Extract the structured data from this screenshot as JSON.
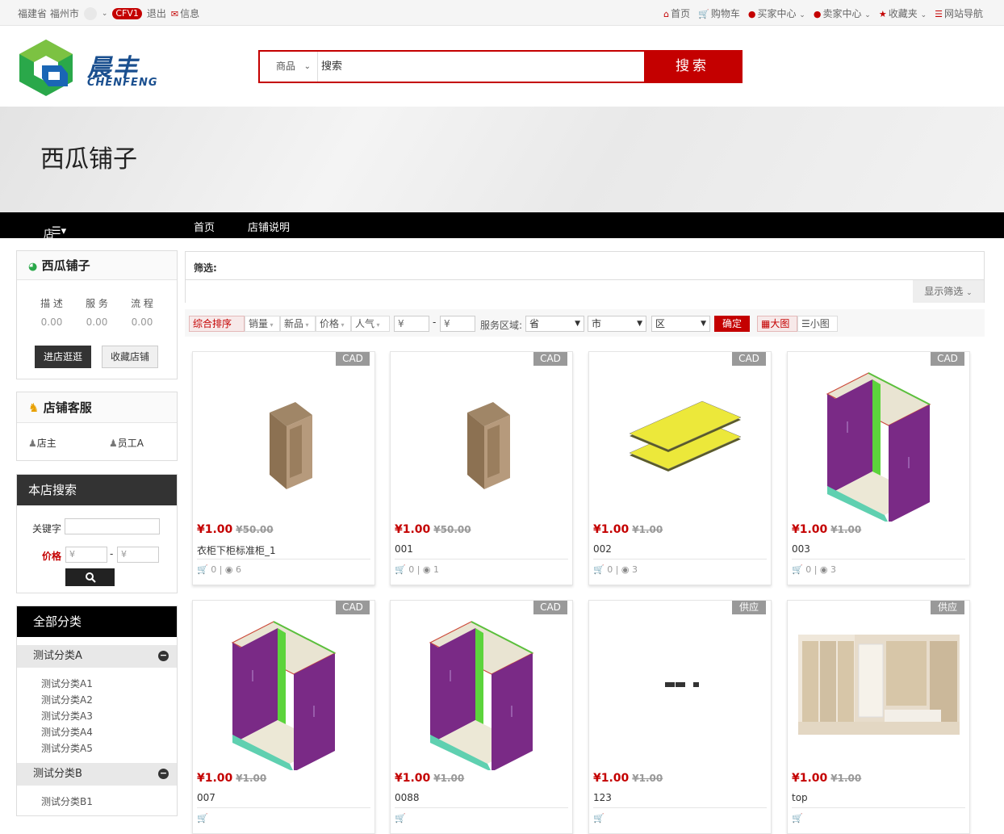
{
  "topbar": {
    "location": "福建省 福州市",
    "version_badge": "CFV1",
    "logout": "退出",
    "messages": "信息",
    "links": [
      "首页",
      "购物车",
      "买家中心",
      "卖家中心",
      "收藏夹",
      "网站导航"
    ]
  },
  "header": {
    "logo_cn": "晨丰",
    "logo_en": "CHENFENG",
    "search_category": "商品",
    "search_value": "搜索",
    "search_button": "搜索"
  },
  "banner": {
    "shop_title": "西瓜铺子"
  },
  "nav": {
    "all_categories": "店铺全部分类",
    "home": "首页",
    "shop_info": "店铺说明"
  },
  "shop_card": {
    "name": "西瓜铺子",
    "stats": [
      {
        "label": "描 述",
        "value": "0.00"
      },
      {
        "label": "服 务",
        "value": "0.00"
      },
      {
        "label": "流 程",
        "value": "0.00"
      }
    ],
    "enter_button": "进店逛逛",
    "favorite_button": "收藏店铺"
  },
  "service": {
    "title": "店铺客服",
    "staff": [
      "店主",
      "员工A"
    ]
  },
  "store_search": {
    "title": "本店搜索",
    "keyword_label": "关键字",
    "price_label": "价格",
    "price_min_placeholder": "¥",
    "price_max_placeholder": "¥",
    "dash": "-"
  },
  "categories": {
    "title": "全部分类",
    "groups": [
      {
        "name": "测试分类A",
        "children": [
          "测试分类A1",
          "测试分类A2",
          "测试分类A3",
          "测试分类A4",
          "测试分类A5"
        ]
      },
      {
        "name": "测试分类B",
        "children": [
          "测试分类B1"
        ]
      }
    ]
  },
  "filter": {
    "label": "筛选:",
    "show_filter": "显示筛选",
    "sort_options": [
      "综合排序",
      "销量",
      "新品",
      "价格",
      "人气"
    ],
    "price_min": "¥",
    "price_max": "¥",
    "dash": "-",
    "area_label": "服务区域:",
    "province": "省",
    "city": "市",
    "district": "区",
    "confirm": "确定",
    "view_large": "大图",
    "view_small": "小图"
  },
  "products": [
    {
      "tag": "CAD",
      "price": "¥1.00",
      "old_price": "¥50.00",
      "name": "衣柜下柜标准柜_1",
      "cart": "0",
      "views": "6",
      "image": "wood-cabinet"
    },
    {
      "tag": "CAD",
      "price": "¥1.00",
      "old_price": "¥50.00",
      "name": "001",
      "cart": "0",
      "views": "1",
      "image": "wood-cabinet"
    },
    {
      "tag": "CAD",
      "price": "¥1.00",
      "old_price": "¥1.00",
      "name": "002",
      "cart": "0",
      "views": "3",
      "image": "yellow-panels"
    },
    {
      "tag": "CAD",
      "price": "¥1.00",
      "old_price": "¥1.00",
      "name": "003",
      "cart": "0",
      "views": "3",
      "image": "purple-cabinet"
    },
    {
      "tag": "CAD",
      "price": "¥1.00",
      "old_price": "¥1.00",
      "name": "007",
      "cart": "",
      "views": "",
      "image": "purple-cabinet"
    },
    {
      "tag": "CAD",
      "price": "¥1.00",
      "old_price": "¥1.00",
      "name": "0088",
      "cart": "",
      "views": "",
      "image": "purple-cabinet"
    },
    {
      "tag": "供应",
      "price": "¥1.00",
      "old_price": "¥1.00",
      "name": "123",
      "cart": "",
      "views": "",
      "image": "broken-image"
    },
    {
      "tag": "供应",
      "price": "¥1.00",
      "old_price": "¥1.00",
      "name": "top",
      "cart": "",
      "views": "",
      "image": "room-photo"
    }
  ]
}
